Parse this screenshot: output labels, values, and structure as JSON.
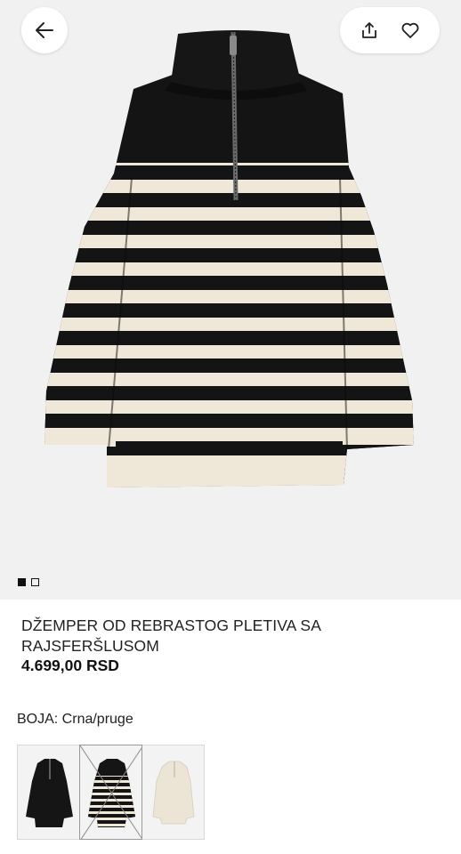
{
  "header": {
    "back_icon": "arrow-left-icon",
    "share_icon": "share-icon",
    "favorite_icon": "heart-icon"
  },
  "gallery": {
    "image_count": 2,
    "active_index": 0
  },
  "product": {
    "title": "DŽEMPER OD REBRASTOG PLETIVA SA RAJSFERŠLUSOM",
    "price": "4.699,00 RSD"
  },
  "color": {
    "label": "BOJA: Crna/pruge",
    "options": [
      {
        "name": "Crna",
        "available": true,
        "selected": false
      },
      {
        "name": "Crna/pruge",
        "available": false,
        "selected": true
      },
      {
        "name": "Bež",
        "available": true,
        "selected": false
      }
    ]
  },
  "colors": {
    "knit_black": "#141414",
    "knit_stripe": "#efe8d8",
    "background": "#f1f1f1"
  }
}
